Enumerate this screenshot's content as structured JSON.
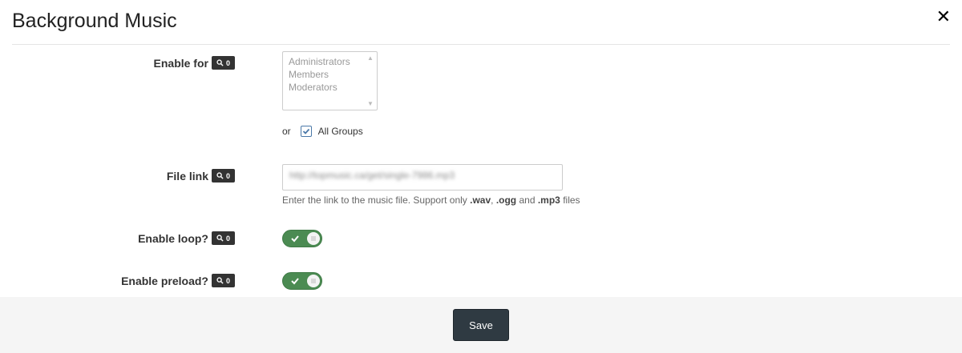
{
  "header": {
    "title": "Background Music",
    "close_label": "✕"
  },
  "fields": {
    "enable_for": {
      "label": "Enable for",
      "badge": "0",
      "options": [
        "Administrators",
        "Members",
        "Moderators"
      ],
      "or_text": "or",
      "all_groups_label": "All Groups",
      "all_groups_checked": true
    },
    "file_link": {
      "label": "File link",
      "badge": "0",
      "value": "http://topmusic.ca/get/single-7986.mp3",
      "help_prefix": "Enter the link to the music file. Support only ",
      "ext_wav": ".wav",
      "sep1": ", ",
      "ext_ogg": ".ogg",
      "sep2": " and ",
      "ext_mp3": ".mp3",
      "help_suffix": " files"
    },
    "enable_loop": {
      "label": "Enable loop?",
      "badge": "0",
      "on": true
    },
    "enable_preload": {
      "label": "Enable preload?",
      "badge": "0",
      "on": true
    }
  },
  "footer": {
    "save_label": "Save"
  },
  "colors": {
    "toggle_on": "#4b8b52",
    "save_bg": "#2f3a42",
    "footer_bg": "#f5f5f5"
  }
}
